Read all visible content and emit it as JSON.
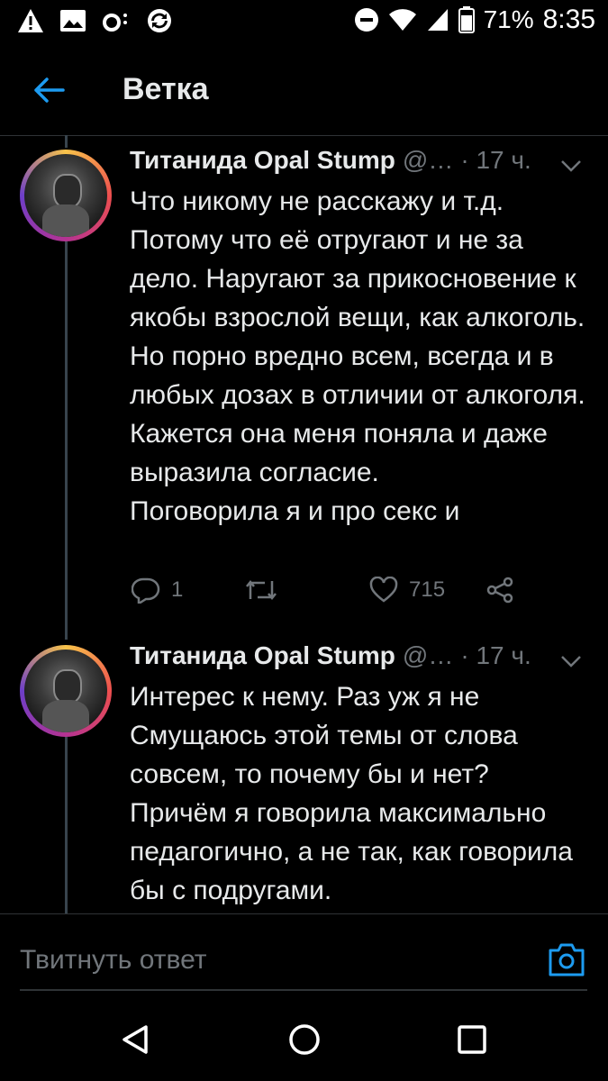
{
  "statusbar": {
    "battery": "71%",
    "time": "8:35",
    "icons": [
      "warning-icon",
      "image-icon",
      "voicemail-icon",
      "sync-icon",
      "dnd-icon",
      "wifi-icon",
      "signal-icon",
      "battery-icon"
    ]
  },
  "appbar": {
    "title": "Ветка"
  },
  "tweets": [
    {
      "name": "Титанида Opal Stump",
      "handle": "@…",
      "time": "· 17 ч.",
      "text": "Что никому не расскажу и т.д.\nПотому что её отругают и не за дело. Наругают за прикосновение к якобы взрослой вещи, как алкоголь. Но порно вредно всем, всегда и в любых дозах в отличии от алкоголя.\nКажется она меня поняла и даже выразила согласие.\nПоговорила я и про секс и",
      "replies": "1",
      "retweets": "",
      "likes": "715"
    },
    {
      "name": "Титанида Opal Stump",
      "handle": "@…",
      "time": "· 17 ч.",
      "text": "Интерес к нему. Раз уж я не Смущаюсь этой темы от слова совсем, то почему бы и нет? Причём я говорила максимально педагогично, а не так, как говорила бы с подругами."
    }
  ],
  "reply": {
    "placeholder": "Твитнуть ответ"
  },
  "colors": {
    "accent": "#1d9bf0",
    "background": "#000000",
    "muted": "#71767b"
  }
}
